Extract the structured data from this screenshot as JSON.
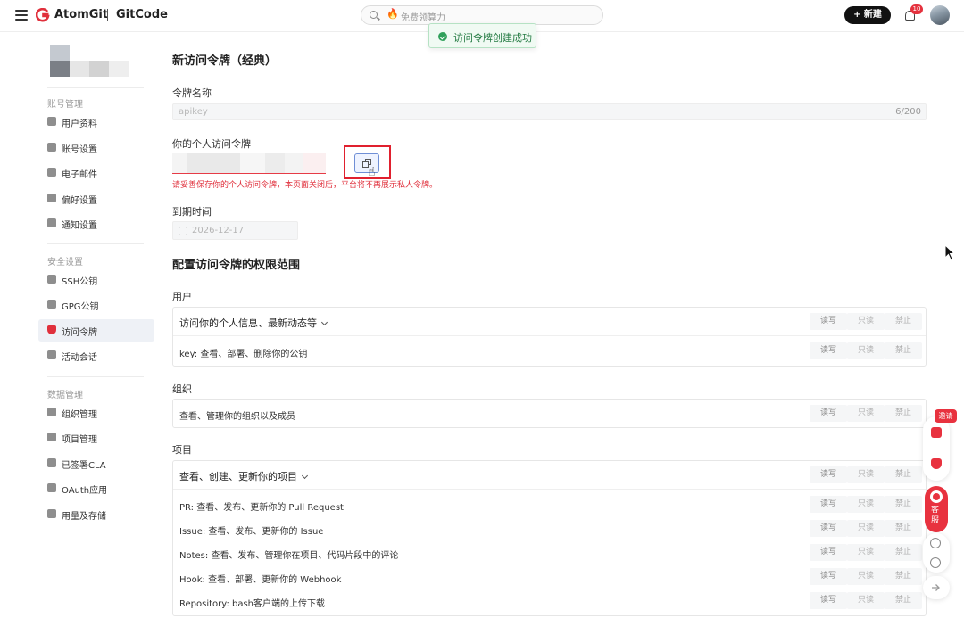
{
  "header": {
    "brand": "AtomGit",
    "product": "GitCode",
    "search_placeholder": "免费领算力",
    "new_button": "+ 新建",
    "notification_count": "10"
  },
  "toast": {
    "message": "访问令牌创建成功"
  },
  "sidebar": {
    "groups": [
      {
        "title": "账号管理",
        "items": [
          {
            "label": "用户资料",
            "icon": "user-icon"
          },
          {
            "label": "账号设置",
            "icon": "gear-icon"
          },
          {
            "label": "电子邮件",
            "icon": "mail-icon"
          },
          {
            "label": "偏好设置",
            "icon": "sliders-icon"
          },
          {
            "label": "通知设置",
            "icon": "bell-gear-icon"
          }
        ]
      },
      {
        "title": "安全设置",
        "items": [
          {
            "label": "SSH公钥",
            "icon": "key-icon"
          },
          {
            "label": "GPG公钥",
            "icon": "key-icon"
          },
          {
            "label": "访问令牌",
            "icon": "shield-icon",
            "active": true
          },
          {
            "label": "活动会话",
            "icon": "signal-icon"
          }
        ]
      },
      {
        "title": "数据管理",
        "items": [
          {
            "label": "组织管理",
            "icon": "org-icon"
          },
          {
            "label": "项目管理",
            "icon": "layers-icon"
          },
          {
            "label": "已签署CLA",
            "icon": "doc-icon"
          },
          {
            "label": "OAuth应用",
            "icon": "shield-check-icon"
          },
          {
            "label": "用量及存储",
            "icon": "pie-icon"
          }
        ]
      }
    ]
  },
  "main": {
    "title": "新访问令牌（经典）",
    "token_name_label": "令牌名称",
    "token_name_value": "apikey",
    "token_name_count": "6/200",
    "token_label": "你的个人访问令牌",
    "warning": "请妥善保存你的个人访问令牌，本页面关闭后，平台将不再展示私人令牌。",
    "expiry_label": "到期时间",
    "expiry_value": "2026-12-17",
    "scope_title": "配置访问令牌的权限范围",
    "perm_labels": {
      "rw": "读写",
      "ro": "只读",
      "none": "禁止"
    },
    "sections": [
      {
        "title": "用户",
        "rows": [
          {
            "text": "访问你的个人信息、最新动态等",
            "expandable": true
          },
          {
            "text": "key:  查看、部署、删除你的公钥"
          }
        ]
      },
      {
        "title": "组织",
        "rows": [
          {
            "text": "查看、管理你的组织以及成员"
          }
        ]
      },
      {
        "title": "项目",
        "rows": [
          {
            "text": "查看、创建、更新你的项目",
            "expandable": true
          },
          {
            "text": "PR:  查看、发布、更新你的 Pull Request"
          },
          {
            "text": "Issue: 查看、发布、更新你的 Issue"
          },
          {
            "text": "Notes: 查看、发布、管理你在项目、代码片段中的评论"
          },
          {
            "text": "Hook: 查看、部署、更新你的 Webhook"
          },
          {
            "text": "Repository: bash客户端的上传下载"
          }
        ]
      }
    ]
  },
  "floating": {
    "invite": "邀请",
    "service": "客服"
  },
  "colors": {
    "accent": "#e0303c",
    "success": "#2fa05a",
    "dark": "#111111"
  }
}
